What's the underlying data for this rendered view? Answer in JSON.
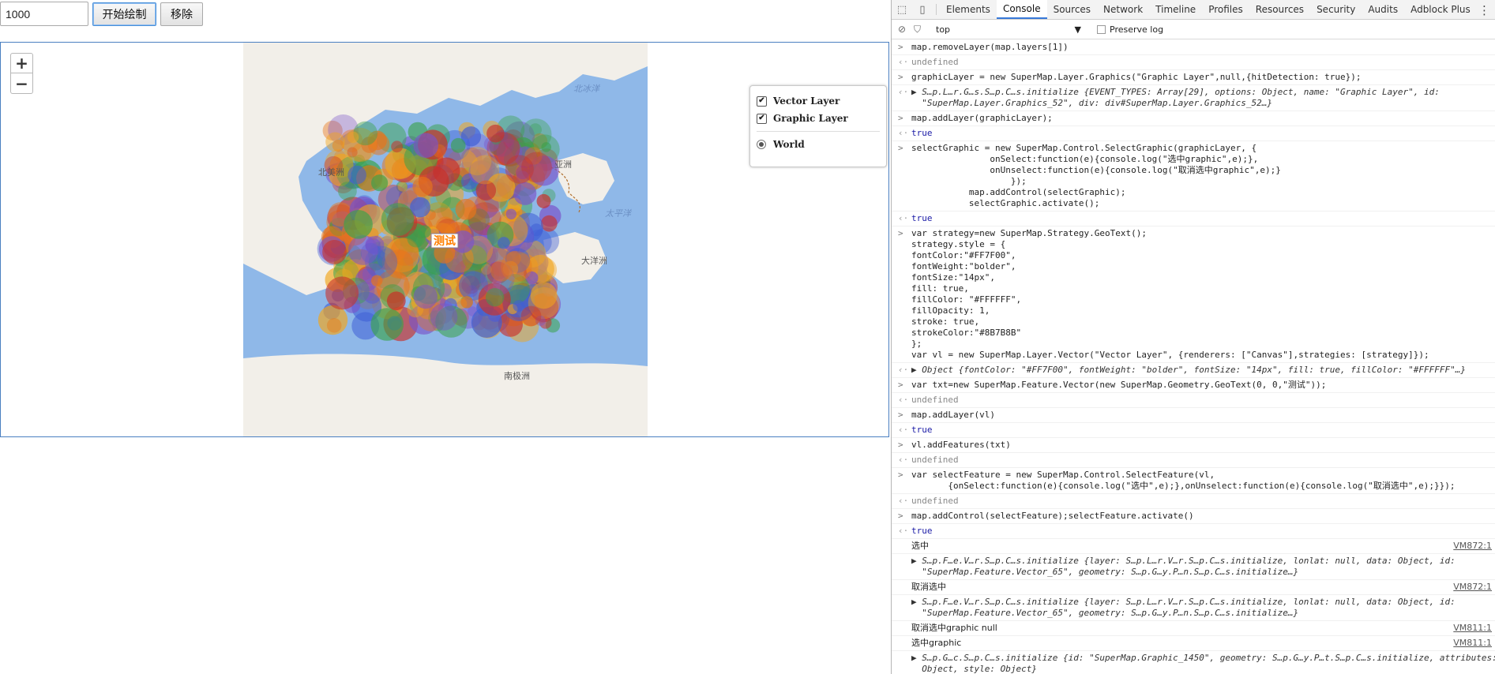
{
  "page": {
    "input_value": "1000",
    "draw_button": "开始绘制",
    "remove_button": "移除",
    "zoom_in": "+",
    "zoom_out": "−"
  },
  "map": {
    "labels": {
      "north_pacific_right": "北冰洋",
      "north_america": "北美洲",
      "asia": "亚洲",
      "pacific": "太平洋",
      "oceania": "大洋洲",
      "antarctica": "南极洲",
      "test_label": "测试"
    },
    "colors": {
      "ocean": "#8fb8e8",
      "land": "#f2efe9",
      "test_text": "#FF7F00",
      "stroke": "#8B7B8B"
    },
    "layers": [
      {
        "name": "Vector Layer",
        "checked": true
      },
      {
        "name": "Graphic Layer",
        "checked": true
      }
    ],
    "base_layer": {
      "name": "World",
      "selected": true
    }
  },
  "devtools": {
    "tabs": [
      "Elements",
      "Console",
      "Sources",
      "Network",
      "Timeline",
      "Profiles",
      "Resources",
      "Security",
      "Audits",
      "Adblock Plus"
    ],
    "active_tab": "Console",
    "context": "top",
    "preserve_log": "Preserve log",
    "messages": [
      {
        "kind": "input",
        "text": "map.removeLayer(map.layers[1])"
      },
      {
        "kind": "result",
        "text": "undefined"
      },
      {
        "kind": "input",
        "text": "graphicLayer = new SuperMap.Layer.Graphics(\"Graphic Layer\",null,{hitDetection: true});"
      },
      {
        "kind": "resultobj",
        "text": "▶ S…p.L…r.G…s.S…p.C…s.initialize {EVENT_TYPES: Array[29], options: Object, name: \"Graphic Layer\", id:\n  \"SuperMap.Layer.Graphics_52\", div: div#SuperMap.Layer.Graphics_52…}"
      },
      {
        "kind": "input",
        "text": "map.addLayer(graphicLayer);"
      },
      {
        "kind": "bool",
        "text": "true"
      },
      {
        "kind": "input",
        "text": "selectGraphic = new SuperMap.Control.SelectGraphic(graphicLayer, {\n               onSelect:function(e){console.log(\"选中graphic\",e);},\n               onUnselect:function(e){console.log(\"取消选中graphic\",e);}\n                   });\n           map.addControl(selectGraphic);\n           selectGraphic.activate();"
      },
      {
        "kind": "bool",
        "text": "true"
      },
      {
        "kind": "input",
        "text": "var strategy=new SuperMap.Strategy.GeoText();\nstrategy.style = {\nfontColor:\"#FF7F00\",\nfontWeight:\"bolder\",\nfontSize:\"14px\",\nfill: true,\nfillColor: \"#FFFFFF\",\nfillOpacity: 1,\nstroke: true,\nstrokeColor:\"#8B7B8B\"\n};\nvar vl = new SuperMap.Layer.Vector(\"Vector Layer\", {renderers: [\"Canvas\"],strategies: [strategy]});"
      },
      {
        "kind": "resultobj",
        "text": "▶ Object {fontColor: \"#FF7F00\", fontWeight: \"bolder\", fontSize: \"14px\", fill: true, fillColor: \"#FFFFFF\"…}"
      },
      {
        "kind": "input",
        "text": "var txt=new SuperMap.Feature.Vector(new SuperMap.Geometry.GeoText(0, 0,\"测试\"));"
      },
      {
        "kind": "result",
        "text": "undefined"
      },
      {
        "kind": "input",
        "text": "map.addLayer(vl)"
      },
      {
        "kind": "bool",
        "text": "true"
      },
      {
        "kind": "input",
        "text": "vl.addFeatures(txt)"
      },
      {
        "kind": "result",
        "text": "undefined"
      },
      {
        "kind": "input",
        "text": "var selectFeature = new SuperMap.Control.SelectFeature(vl,\n       {onSelect:function(e){console.log(\"选中\",e);},onUnselect:function(e){console.log(\"取消选中\",e);}});"
      },
      {
        "kind": "result",
        "text": "undefined"
      },
      {
        "kind": "input",
        "text": "map.addControl(selectFeature);selectFeature.activate()"
      },
      {
        "kind": "bool",
        "text": "true"
      },
      {
        "kind": "log",
        "text": "选中",
        "src": "VM872:1"
      },
      {
        "kind": "obj",
        "text": "▶ S…p.F…e.V…r.S…p.C…s.initialize {layer: S…p.L…r.V…r.S…p.C…s.initialize, lonlat: null, data: Object, id:\n  \"SuperMap.Feature.Vector_65\", geometry: S…p.G…y.P…n.S…p.C…s.initialize…}"
      },
      {
        "kind": "log",
        "text": "取消选中",
        "src": "VM872:1"
      },
      {
        "kind": "obj",
        "text": "▶ S…p.F…e.V…r.S…p.C…s.initialize {layer: S…p.L…r.V…r.S…p.C…s.initialize, lonlat: null, data: Object, id:\n  \"SuperMap.Feature.Vector_65\", geometry: S…p.G…y.P…n.S…p.C…s.initialize…}"
      },
      {
        "kind": "log",
        "text": "取消选中graphic null",
        "src": "VM811:1"
      },
      {
        "kind": "log",
        "text": "选中graphic",
        "src": "VM811:1"
      },
      {
        "kind": "obj",
        "text": "▶ S…p.G…c.S…p.C…s.initialize {id: \"SuperMap.Graphic_1450\", geometry: S…p.G…y.P…t.S…p.C…s.initialize, attributes:\n  Object, style: Object}"
      }
    ]
  }
}
